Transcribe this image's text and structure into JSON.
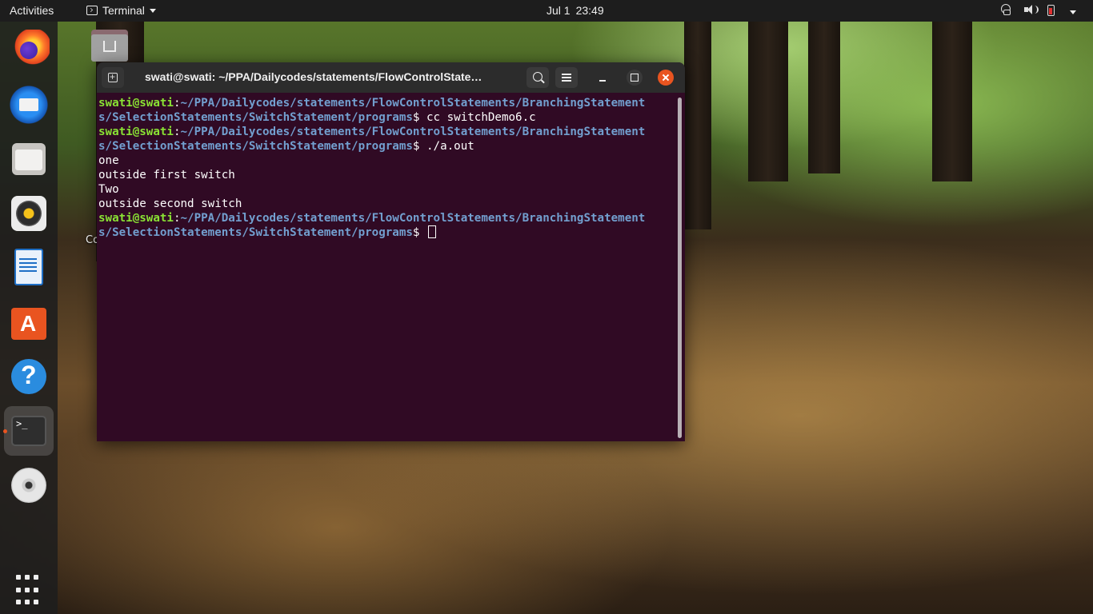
{
  "topbar": {
    "activities": "Activities",
    "app_name": "Terminal",
    "clock_date": "Jul 1",
    "clock_time": "23:49",
    "tray_icons": [
      "network-icon",
      "volume-icon",
      "battery-icon",
      "power-menu-icon"
    ]
  },
  "dock": {
    "items": [
      {
        "name": "Firefox",
        "icon": "firefox-icon"
      },
      {
        "name": "Thunderbird",
        "icon": "thunderbird-icon"
      },
      {
        "name": "Files",
        "icon": "files-icon"
      },
      {
        "name": "Rhythmbox",
        "icon": "rhythmbox-icon"
      },
      {
        "name": "LibreOffice Writer",
        "icon": "writer-icon"
      },
      {
        "name": "Ubuntu Software",
        "icon": "app-center-icon"
      },
      {
        "name": "Help",
        "icon": "help-icon"
      },
      {
        "name": "Terminal",
        "icon": "terminal-icon",
        "active": true
      },
      {
        "name": "Disc",
        "icon": "dvd-icon"
      },
      {
        "name": "Show Applications",
        "icon": "apps-grid-icon"
      }
    ]
  },
  "desktop": {
    "partial_label": "Co"
  },
  "window": {
    "title": "swati@swati: ~/PPA/Dailycodes/statements/FlowControlState…",
    "buttons": [
      "new-tab",
      "search",
      "menu",
      "minimize",
      "maximize",
      "close"
    ]
  },
  "terminal": {
    "lines": [
      {
        "type": "prompt-start",
        "user": "swati@swati",
        "sep": ":",
        "path": "~/PPA/Dailycodes/statements/FlowControlStatements/BranchingStatement"
      },
      {
        "type": "prompt-end",
        "path": "s/SelectionStatements/SwitchStatement/programs",
        "sign": "$ ",
        "cmd": "cc switchDemo6.c"
      },
      {
        "type": "prompt-start",
        "user": "swati@swati",
        "sep": ":",
        "path": "~/PPA/Dailycodes/statements/FlowControlStatements/BranchingStatement"
      },
      {
        "type": "prompt-end",
        "path": "s/SelectionStatements/SwitchStatement/programs",
        "sign": "$ ",
        "cmd": "./a.out"
      },
      {
        "type": "output",
        "text": "one"
      },
      {
        "type": "output",
        "text": "outside first switch"
      },
      {
        "type": "output",
        "text": "Two"
      },
      {
        "type": "output",
        "text": "outside second switch"
      },
      {
        "type": "prompt-start",
        "user": "swati@swati",
        "sep": ":",
        "path": "~/PPA/Dailycodes/statements/FlowControlStatements/BranchingStatement"
      },
      {
        "type": "prompt-end",
        "path": "s/SelectionStatements/SwitchStatement/programs",
        "sign": "$ ",
        "cmd": "",
        "cursor": true
      }
    ],
    "colors": {
      "background": "#300a24",
      "user": "#8ae234",
      "path": "#729fcf",
      "text": "#ffffff"
    }
  }
}
